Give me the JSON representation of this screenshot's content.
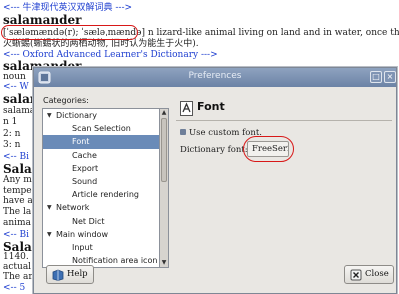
{
  "background": {
    "lines": [
      {
        "text": "<--- 牛津现代英汉双解词典 --->",
        "kind": "link"
      },
      {
        "text": "salamander",
        "kind": "head"
      },
      {
        "text": "[ˈsæləmændə(r); ˈsæləˌmændə] n lizard-like animal living on land and in water, once thought to be capable",
        "kind": "text"
      },
      {
        "text": "火蜥蜴(蜥蜴状的两栖动物, 旧时认为能生于火中).",
        "kind": "text"
      },
      {
        "text": "<--- Oxford Advanced Learner's Dictionary --->",
        "kind": "link"
      },
      {
        "text": "salamander",
        "kind": "head"
      },
      {
        "text": "noun",
        "kind": "text"
      },
      {
        "text": "<--  W",
        "kind": "link"
      },
      {
        "text": "salam",
        "kind": "head"
      },
      {
        "text": "salama",
        "kind": "text"
      },
      {
        "text": "n 1",
        "kind": "text"
      },
      {
        "text": "2: n",
        "kind": "text"
      },
      {
        "text": "3: n",
        "kind": "text"
      },
      {
        "text": "<--  Bi",
        "kind": "link"
      },
      {
        "text": "Salar",
        "kind": "head"
      },
      {
        "text": "Any m",
        "kind": "text"
      },
      {
        "text": "tempe",
        "kind": "text"
      },
      {
        "text": "have a",
        "kind": "text"
      },
      {
        "text": "The la",
        "kind": "text"
      },
      {
        "text": "anima",
        "kind": "text"
      },
      {
        "text": "<--  Bi",
        "kind": "link"
      },
      {
        "text": "Salar",
        "kind": "head"
      },
      {
        "text": "1140. S",
        "kind": "text"
      },
      {
        "text": "actual",
        "kind": "text"
      },
      {
        "text": "The an",
        "kind": "text"
      },
      {
        "text": "<--  5",
        "kind": "link"
      }
    ]
  },
  "dialog": {
    "title": "Preferences",
    "categories_label": "Categories:",
    "tree": [
      {
        "label": "Dictionary",
        "level": 0,
        "expanded": true,
        "selected": false
      },
      {
        "label": "Scan Selection",
        "level": 1,
        "selected": false
      },
      {
        "label": "Font",
        "level": 1,
        "selected": true
      },
      {
        "label": "Cache",
        "level": 1,
        "selected": false
      },
      {
        "label": "Export",
        "level": 1,
        "selected": false
      },
      {
        "label": "Sound",
        "level": 1,
        "selected": false
      },
      {
        "label": "Article rendering",
        "level": 1,
        "selected": false
      },
      {
        "label": "Network",
        "level": 0,
        "expanded": true,
        "selected": false
      },
      {
        "label": "Net Dict",
        "level": 1,
        "selected": false
      },
      {
        "label": "Main window",
        "level": 0,
        "expanded": true,
        "selected": false
      },
      {
        "label": "Input",
        "level": 1,
        "selected": false
      },
      {
        "label": "Notification area icon",
        "level": 1,
        "selected": false
      }
    ],
    "pane": {
      "title": "Font",
      "use_custom_font_label": "Use custom font.",
      "use_custom_font_checked": true,
      "dictionary_font_label": "Dictionary font:",
      "dictionary_font_value": "FreeSerif 10"
    },
    "buttons": {
      "help": "Help",
      "close": "Close"
    },
    "colors": {
      "titlebar": "#7d93b4",
      "selection": "#6a8bb8",
      "highlight_circle": "#d81818"
    }
  }
}
